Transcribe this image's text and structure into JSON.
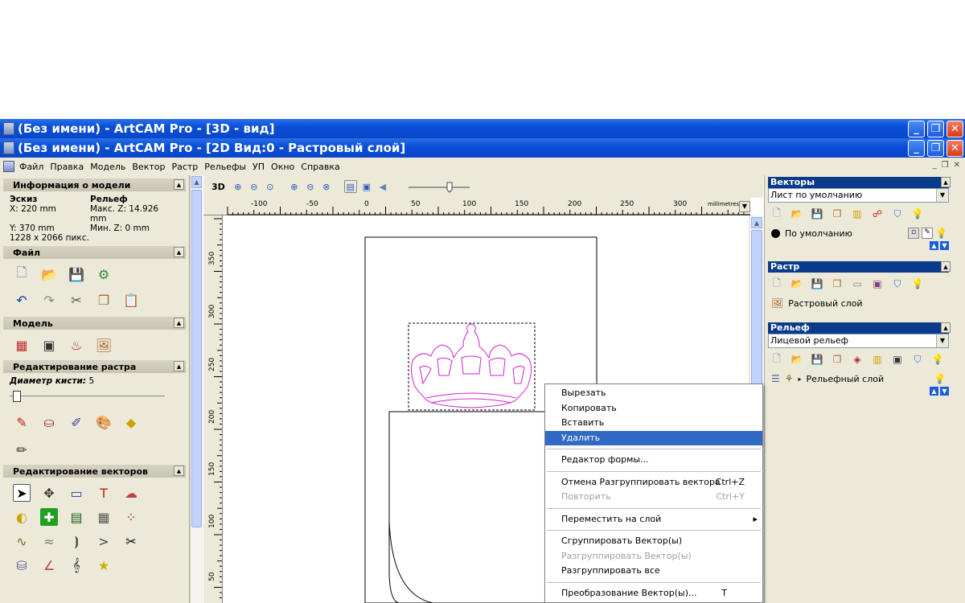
{
  "windows": {
    "outer_title": "(Без имени) - ArtCAM Pro - [3D - вид]",
    "inner_title": "(Без имени) - ArtCAM Pro - [2D Вид:0 - Растровый слой]"
  },
  "menubar": {
    "items": [
      "Файл",
      "Правка",
      "Модель",
      "Вектор",
      "Растр",
      "Рельефы",
      "УП",
      "Окно",
      "Справка"
    ]
  },
  "left_panel": {
    "model_info": {
      "title": "Информация о модели",
      "sketch_label": "Эскиз",
      "relief_label": "Рельеф",
      "x": "X: 220 mm",
      "max_z": "Макс. Z: 14.926 mm",
      "y": "Y: 370 mm",
      "min_z": "Мин. Z: 0 mm",
      "pixels": "1228 x 2066 пикс."
    },
    "file_title": "Файл",
    "model_title": "Модель",
    "raster_edit_title": "Редактирование растра",
    "brush_label": "Диаметр кисти:",
    "brush_value": "5",
    "vector_edit_title": "Редактирование векторов"
  },
  "view": {
    "toolbar_3d": "3D",
    "ruler_unit": "millimetres",
    "h_ticks": [
      "-100",
      "-50",
      "0",
      "50",
      "100",
      "150",
      "200",
      "250",
      "300"
    ],
    "v_ticks": [
      "350",
      "300",
      "250",
      "200",
      "150",
      "100",
      "50"
    ]
  },
  "right_panel": {
    "vectors_title": "Векторы",
    "vectors_sheet": "Лист по умолчанию",
    "vectors_layer": "По умолчанию",
    "raster_title": "Растр",
    "raster_layer": "Растровый слой",
    "relief_title": "Рельеф",
    "relief_sheet": "Лицевой рельеф",
    "relief_layer": "Рельефный слой"
  },
  "context_menu": {
    "items": [
      {
        "label": "Вырезать",
        "shortcut": "",
        "state": "normal"
      },
      {
        "label": "Копировать",
        "shortcut": "",
        "state": "normal"
      },
      {
        "label": "Вставить",
        "shortcut": "",
        "state": "normal"
      },
      {
        "label": "Удалить",
        "shortcut": "",
        "state": "active"
      },
      {
        "label": "Редактор формы...",
        "shortcut": "",
        "state": "normal"
      },
      {
        "label": "Отмена Разгруппировать вектора",
        "shortcut": "Ctrl+Z",
        "state": "normal"
      },
      {
        "label": "Повторить",
        "shortcut": "Ctrl+Y",
        "state": "disabled"
      },
      {
        "label": "Переместить на слой",
        "shortcut": "▸",
        "state": "normal"
      },
      {
        "label": "Сгруппировать Вектор(ы)",
        "shortcut": "",
        "state": "normal"
      },
      {
        "label": "Разгруппировать Вектор(ы)",
        "shortcut": "",
        "state": "disabled"
      },
      {
        "label": "Разгруппировать все",
        "shortcut": "",
        "state": "normal"
      },
      {
        "label": "Преобразование Вектор(ы)...",
        "shortcut": "T",
        "state": "normal"
      }
    ]
  },
  "colors": {
    "title_blue": "#0a4fd8",
    "panel_bg": "#ece9d8",
    "highlight": "#316ac5",
    "crown_magenta": "#d020d0"
  }
}
